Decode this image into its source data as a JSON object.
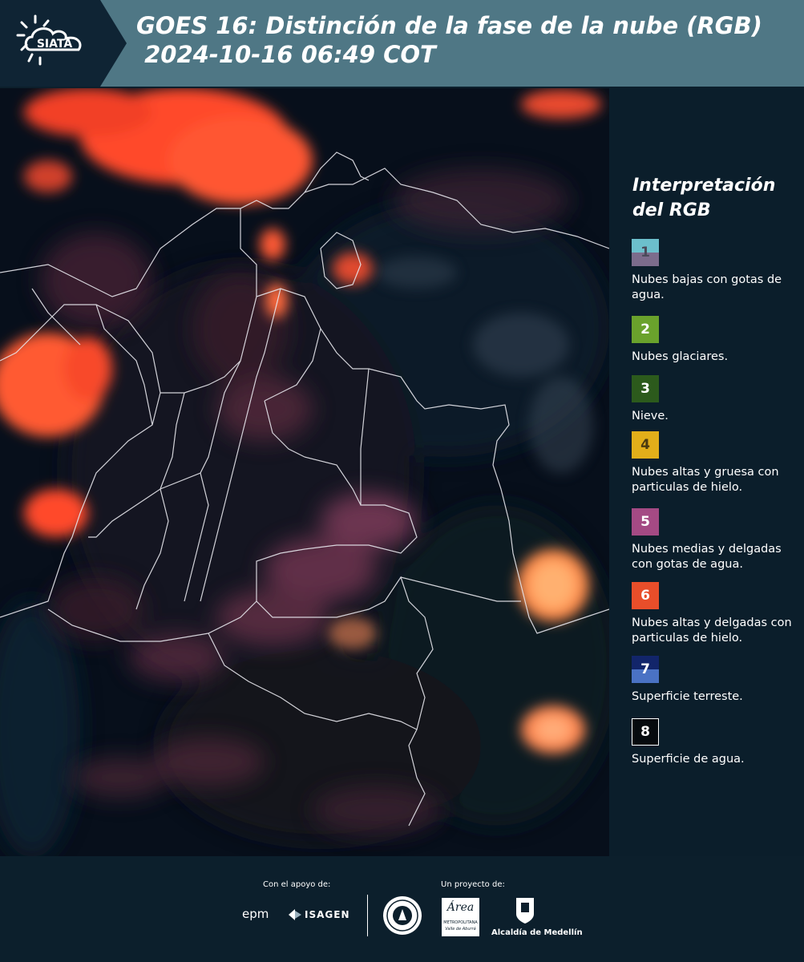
{
  "header": {
    "logo_text": "SIATA",
    "title": "GOES 16: Distinción de la fase de la nube (RGB)\n 2024-10-16 06:49 COT"
  },
  "map": {
    "description": "satellite-rgb-map-colombia"
  },
  "legend": {
    "title": "Interpretación del RGB",
    "items": [
      {
        "num": "1",
        "text": "Nubes bajas con gotas de agua.",
        "color_top": "#6cbfcc",
        "color_bottom": "#7c6c8c"
      },
      {
        "num": "2",
        "text": "Nubes glaciares.",
        "color_top": "#6aa22c",
        "color_bottom": "#6aa22c"
      },
      {
        "num": "3",
        "text": "Nieve.",
        "color_top": "#2c5a1c",
        "color_bottom": "#2c5a1c"
      },
      {
        "num": "4",
        "text": "Nubes altas y gruesa con particulas de hielo.",
        "color_top": "#e2ae1a",
        "color_bottom": "#e2ae1a"
      },
      {
        "num": "5",
        "text": "Nubes medias y delgadas con gotas de agua.",
        "color_top": "#a44a84",
        "color_bottom": "#a44a84"
      },
      {
        "num": "6",
        "text": "Nubes altas y delgadas con particulas de hielo.",
        "color_top": "#e84e2a",
        "color_bottom": "#e84e2a"
      },
      {
        "num": "7",
        "text": "Superficie terreste.",
        "color_top": "#12256a",
        "color_bottom": "#4a72c4"
      },
      {
        "num": "8",
        "text": "Superficie de agua.",
        "color_top": "#060a0e",
        "color_bottom": "#060a0e"
      }
    ]
  },
  "footer": {
    "support_label": "Con el apoyo de:",
    "project_label": "Un proyecto de:",
    "epm": "epm",
    "isagen": "ISAGEN",
    "area_name": "Área",
    "area_sub1": "METROPOLITANA",
    "area_sub2": "Valle de Aburrá",
    "alcaldia": "Alcaldía de Medellín"
  }
}
